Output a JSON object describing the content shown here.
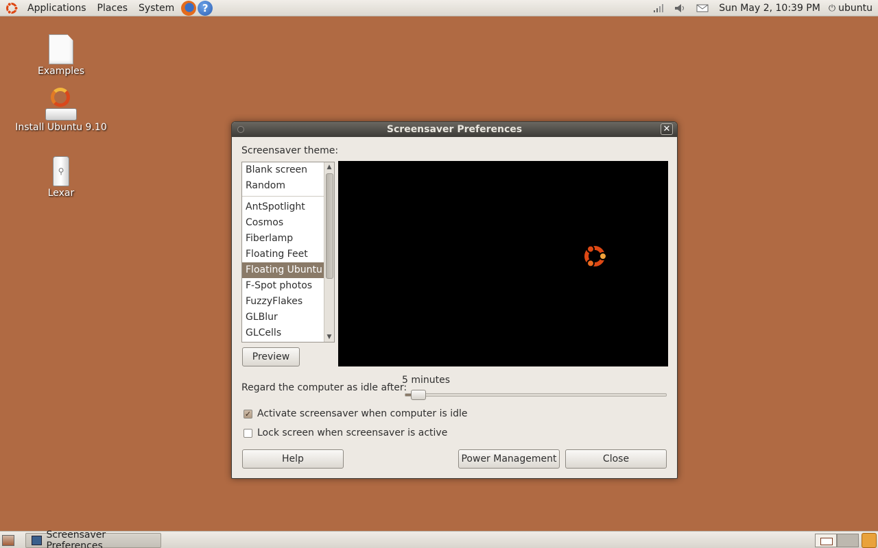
{
  "top_panel": {
    "menus": [
      "Applications",
      "Places",
      "System"
    ],
    "clock": "Sun May  2, 10:39 PM",
    "user": "ubuntu"
  },
  "desktop": {
    "icons": [
      {
        "label": "Examples",
        "icon": "document-icon"
      },
      {
        "label": "Install Ubuntu 9.10",
        "icon": "installer-icon"
      },
      {
        "label": "Lexar",
        "icon": "usb-drive-icon"
      }
    ]
  },
  "dialog": {
    "title": "Screensaver Preferences",
    "theme_label": "Screensaver theme:",
    "themes": [
      "Blank screen",
      "Random",
      "AntSpotlight",
      "Cosmos",
      "Fiberlamp",
      "Floating Feet",
      "Floating Ubuntu",
      "F-Spot photos",
      "FuzzyFlakes",
      "GLBlur",
      "GLCells"
    ],
    "selected_theme": "Floating Ubuntu",
    "preview_button": "Preview",
    "idle_label": "Regard the computer as idle after:",
    "idle_value": "5 minutes",
    "idle_slider_fraction": 0.05,
    "activate_label": "Activate screensaver when computer is idle",
    "activate_checked": true,
    "lock_label": "Lock screen when screensaver is active",
    "lock_checked": false,
    "help_button": "Help",
    "power_button": "Power Management",
    "close_button": "Close"
  },
  "bottom_panel": {
    "task": "Screensaver Preferences"
  },
  "colors": {
    "desktop_bg": "#b06a43",
    "selection": "#8a7a68"
  }
}
